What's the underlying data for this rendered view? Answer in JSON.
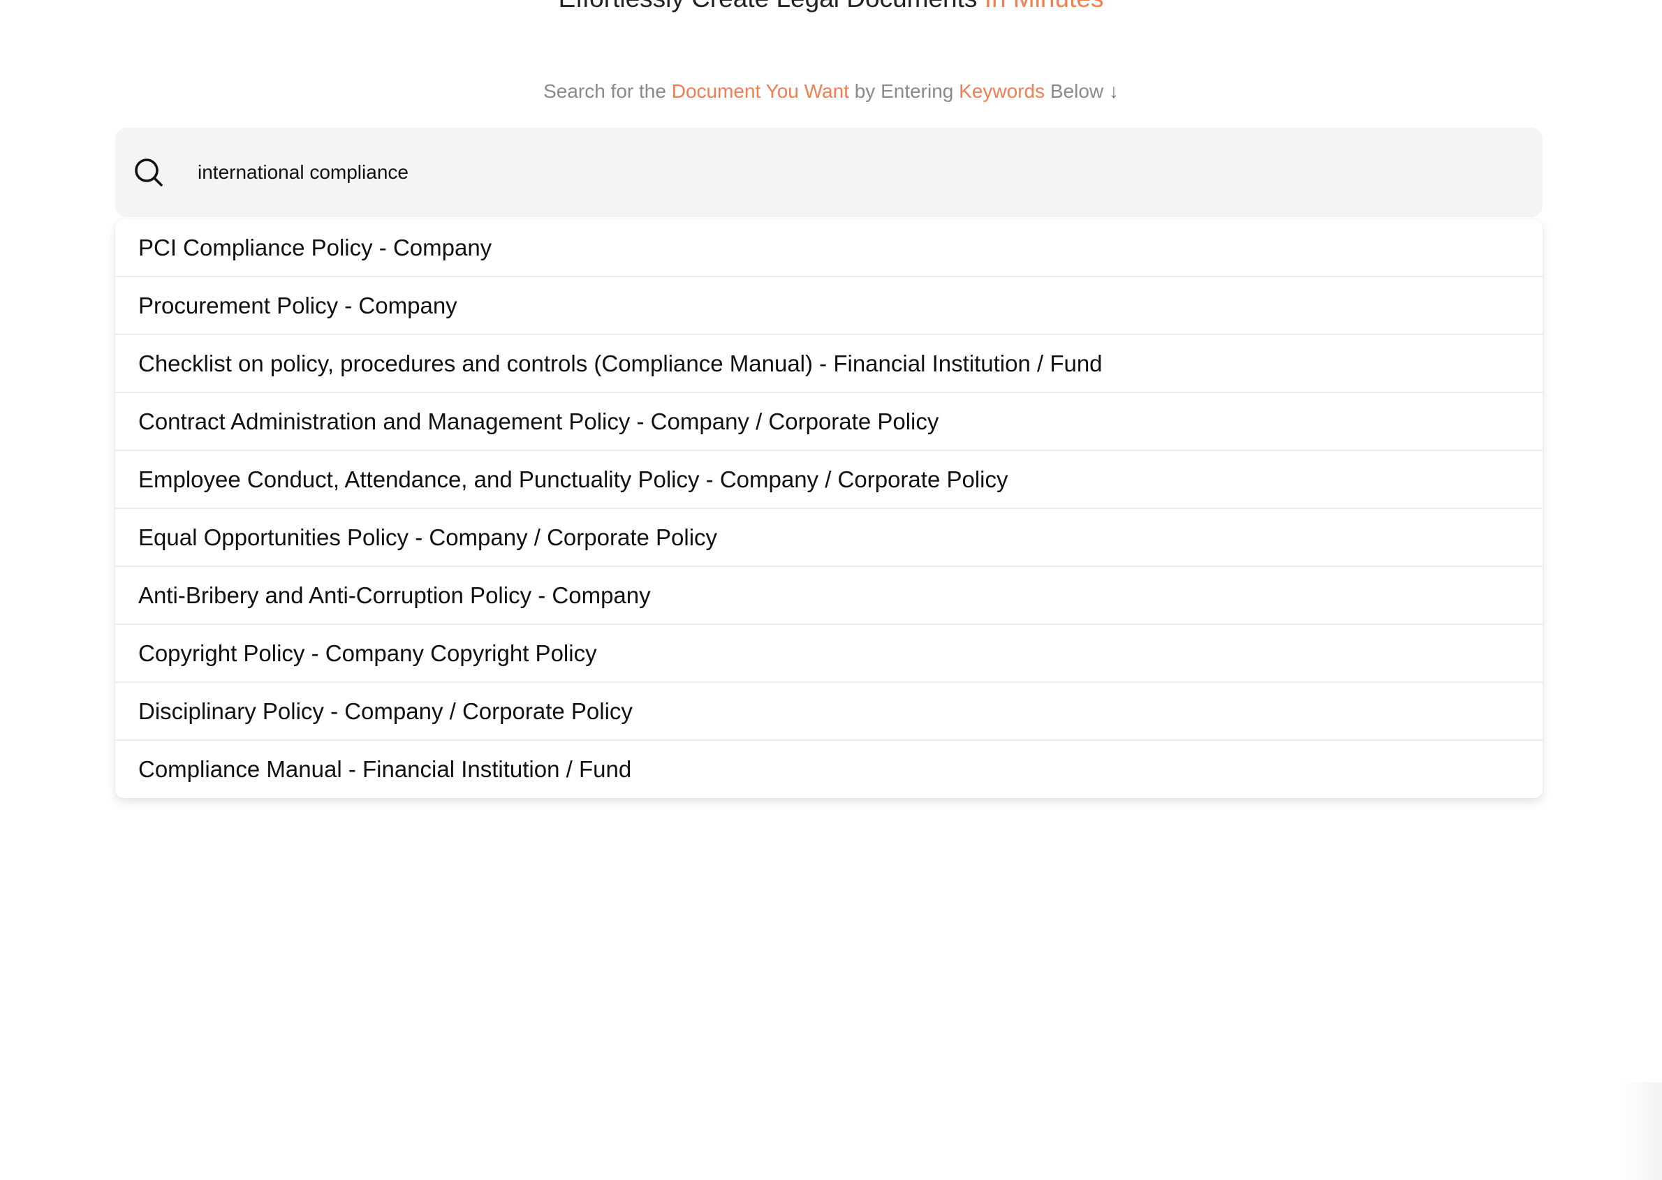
{
  "hero": {
    "title_main": "Effortlessly Create Legal Documents",
    "title_accent": "In Minutes"
  },
  "subtitle": {
    "part1": "Search for the",
    "accent1": "Document You Want",
    "part2": "by Entering",
    "accent2": "Keywords",
    "part3": "Below",
    "arrow": "↓"
  },
  "search": {
    "icon": "search-icon",
    "value": "international compliance",
    "placeholder": ""
  },
  "results": [
    "PCI Compliance Policy - Company",
    "Procurement Policy - Company",
    "Checklist on policy, procedures and controls (Compliance Manual) - Financial Institution / Fund",
    "Contract Administration and Management Policy - Company / Corporate Policy",
    "Employee Conduct, Attendance, and Punctuality Policy - Company / Corporate Policy",
    "Equal Opportunities Policy - Company / Corporate Policy",
    "Anti-Bribery and Anti-Corruption Policy - Company",
    "Copyright Policy - Company Copyright Policy",
    "Disciplinary Policy - Company / Corporate Policy",
    "Compliance Manual - Financial Institution / Fund"
  ],
  "colors": {
    "accent": "#ef7e50",
    "search_bg": "#f4f4f4",
    "subtitle_text": "#8a8a8a"
  }
}
